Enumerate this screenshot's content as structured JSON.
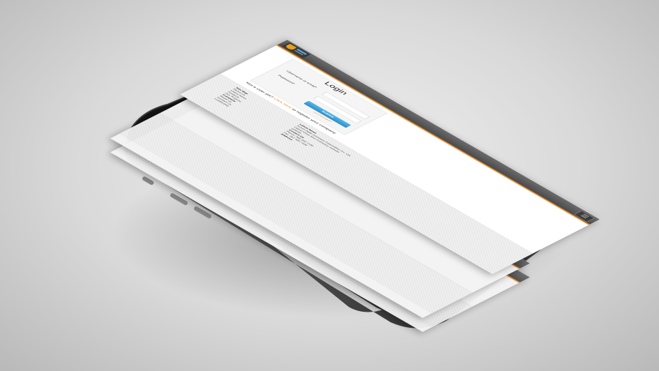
{
  "login": {
    "title": "Login",
    "username_label": "Username or email*",
    "password_label": "Password*",
    "submit_label": "Submit",
    "lost_password": "Lost Password?"
  },
  "register": {
    "prefix": "Not a user yet? ",
    "link": "Click here",
    "suffix": " to register your company"
  },
  "header": {
    "menu_icon": "hamburger-icon",
    "menu_glyph": "☰"
  },
  "footer": {
    "sitemap_heading": "Site Map",
    "sitemap_items": [
      "About Us",
      "Latest News",
      "Products",
      "Our Projects"
    ],
    "company_heading": "Company",
    "company_items": [
      "About Us",
      "Contact Us",
      "Leadership"
    ],
    "news_heading": "Latest News",
    "news_items": [
      "Scrum Agile Company Corporation Inc. Ltd.",
      "Latest News from Company website",
      "website"
    ],
    "contact_heading": "Contact Us",
    "contact_items": [
      "Phone: 380 340 7130",
      "Fax: 357 350 7039"
    ],
    "address_heading": "Address"
  },
  "colors": {
    "accent": "#f08a1c",
    "button": "#2b8dcb",
    "topbar": "#555555",
    "phone_body": "#1c1c1c"
  }
}
